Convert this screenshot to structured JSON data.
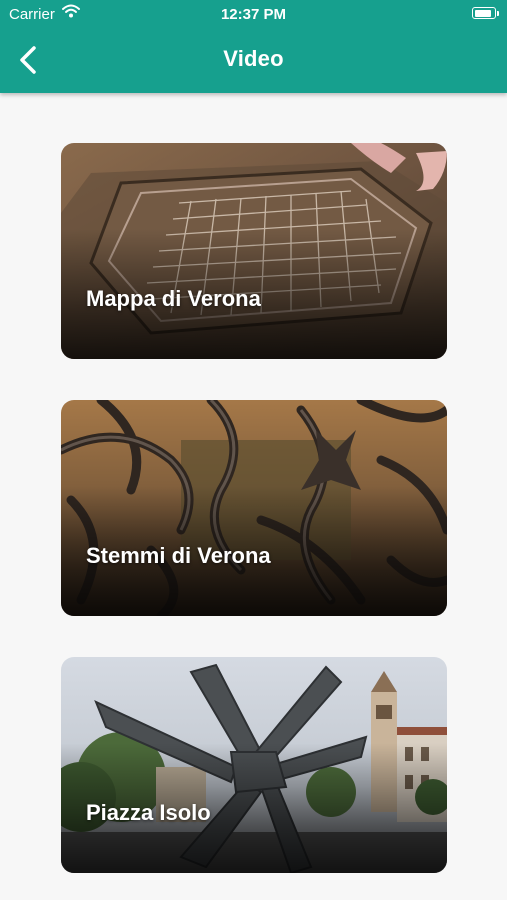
{
  "status_bar": {
    "carrier": "Carrier",
    "time": "12:37 PM",
    "battery_level": 0.9
  },
  "header": {
    "title": "Video",
    "back_icon": "chevron-left-icon"
  },
  "videos": [
    {
      "label": "Mappa di Verona"
    },
    {
      "label": "Stemmi di Verona"
    },
    {
      "label": "Piazza Isolo"
    }
  ],
  "colors": {
    "accent": "#16a08e",
    "background": "#f7f7f7"
  }
}
